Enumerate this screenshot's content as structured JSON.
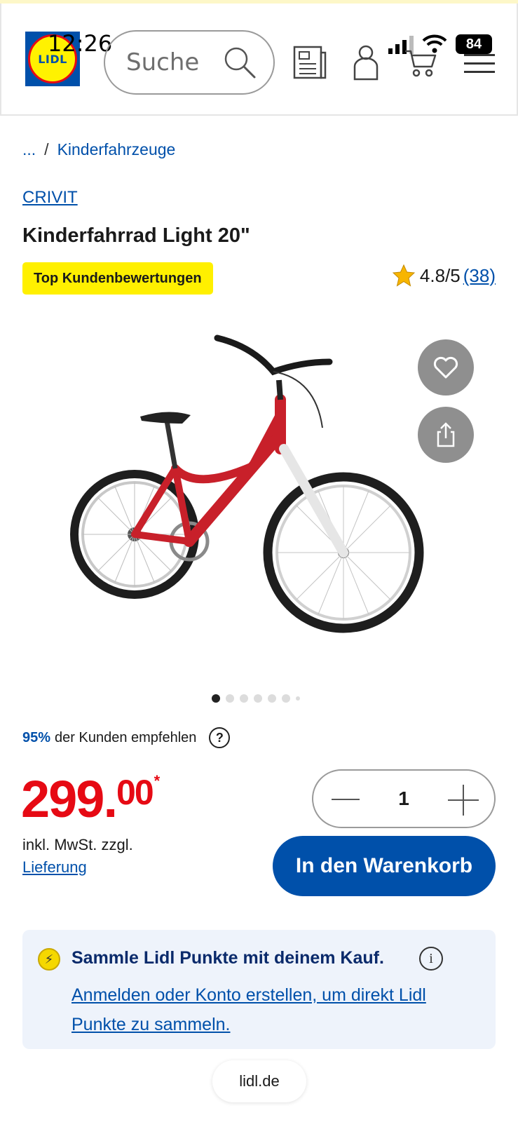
{
  "status_bar": {
    "time": "12:26",
    "battery": "84"
  },
  "header": {
    "logo_text": "LIDL",
    "search_placeholder": "Suche",
    "icons": [
      "search-icon",
      "prospekt-icon",
      "account-icon",
      "cart-icon",
      "menu-icon"
    ]
  },
  "breadcrumb": {
    "ellipsis": "...",
    "separator": "/",
    "category": "Kinderfahrzeuge"
  },
  "product": {
    "brand": "CRIVIT",
    "title": "Kinderfahrrad Light 20\"",
    "badge": "Top Kundenbewertungen",
    "rating": "4.8/5",
    "review_count": "(38)",
    "image_slide_index": 1,
    "image_slide_count": 7,
    "recommend_pct": "95%",
    "recommend_text": "der Kunden empfehlen",
    "recommend_help": "?",
    "price_main": "299.",
    "price_cents": "00",
    "price_asterisk": "*",
    "tax_text": "inkl. MwSt. zzgl.",
    "delivery_link": "Lieferung",
    "quantity": "1",
    "add_to_cart": "In den Warenkorb"
  },
  "points": {
    "heading": "Sammle Lidl Punkte mit deinem Kauf.",
    "info": "i",
    "link": "Anmelden oder Konto erstellen, um direkt Lidl Punkte zu sammeln."
  },
  "browser": {
    "url": "lidl.de"
  },
  "colors": {
    "brand_blue": "#0050aa",
    "price_red": "#e60a14",
    "badge_yellow": "#fff000",
    "logo_yellow": "#fff200"
  }
}
